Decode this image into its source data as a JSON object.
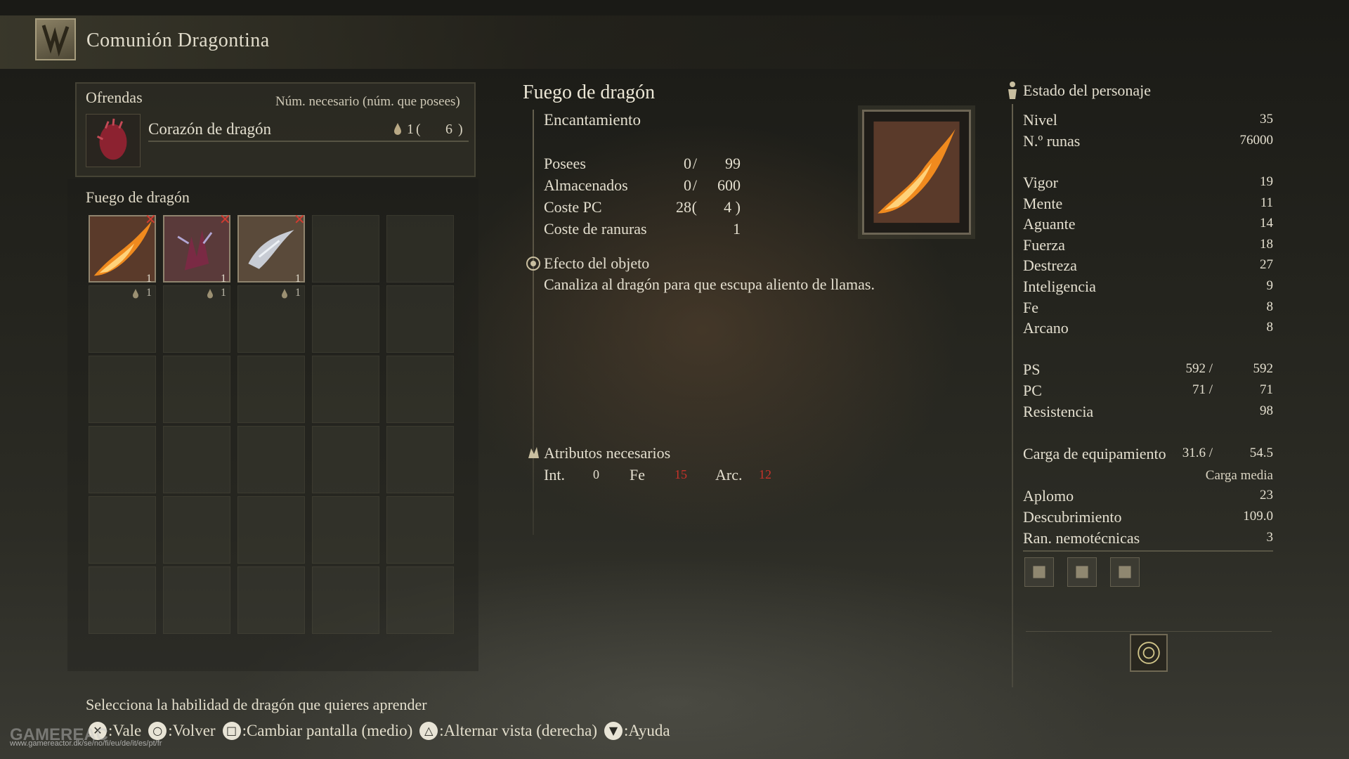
{
  "header": {
    "title": "Comunión Dragontina",
    "icon": "dragon-communion-icon"
  },
  "offerings": {
    "title": "Ofrendas",
    "column_header": "Núm. necesario (núm. que posees)",
    "item": {
      "name": "Corazón de dragón",
      "required": "1",
      "paren_open": "(",
      "owned": "6",
      "paren_close": ")",
      "icon": "dragon-heart-icon"
    }
  },
  "grid": {
    "title": "Fuego de dragón",
    "items": [
      {
        "icon": "dragonfire-icon",
        "qty": "1",
        "cost": "1",
        "remove": "✕"
      },
      {
        "icon": "dragonclaw-icon",
        "qty": "1",
        "cost": "1",
        "remove": "✕"
      },
      {
        "icon": "dragonice-icon",
        "qty": "1",
        "cost": "1",
        "remove": "✕"
      }
    ]
  },
  "detail": {
    "name": "Fuego de dragón",
    "type": "Encantamiento",
    "stats": [
      {
        "label": "Posees",
        "v1": "0",
        "sep": "/",
        "v2": "99"
      },
      {
        "label": "Almacenados",
        "v1": "0",
        "sep": "/",
        "v2": "600"
      },
      {
        "label": "Coste PC",
        "v1": "28",
        "sep": "(",
        "v2": "4 )"
      },
      {
        "label": "Coste de ranuras",
        "v1": "",
        "sep": "",
        "v2": "1"
      }
    ],
    "effect_title": "Efecto del objeto",
    "effect_desc": "Canaliza al dragón para que escupa aliento de llamas.",
    "attributes_title": "Atributos necesarios",
    "attributes": [
      {
        "label": "Int.",
        "value": "0",
        "color": "#e4dfcf"
      },
      {
        "label": "Fe",
        "value": "15",
        "color": "#c8322a"
      },
      {
        "label": "Arc.",
        "value": "12",
        "color": "#c8322a"
      }
    ]
  },
  "character": {
    "title": "Estado del personaje",
    "level_label": "Nivel",
    "level": "35",
    "runes_label": "N.º runas",
    "runes": "76000",
    "attributes": [
      {
        "label": "Vigor",
        "value": "19"
      },
      {
        "label": "Mente",
        "value": "11"
      },
      {
        "label": "Aguante",
        "value": "14"
      },
      {
        "label": "Fuerza",
        "value": "18"
      },
      {
        "label": "Destreza",
        "value": "27"
      },
      {
        "label": "Inteligencia",
        "value": "9"
      },
      {
        "label": "Fe",
        "value": "8"
      },
      {
        "label": "Arcano",
        "value": "8"
      }
    ],
    "hp_label": "PS",
    "hp_cur": "592 /",
    "hp_max": "592",
    "fp_label": "PC",
    "fp_cur": "71 /",
    "fp_max": "71",
    "stamina_label": "Resistencia",
    "stamina": "98",
    "load_label": "Carga de equipamiento",
    "load_cur": "31.6 /",
    "load_max": "54.5",
    "load_state": "Carga media",
    "poise_label": "Aplomo",
    "poise": "23",
    "discovery_label": "Descubrimiento",
    "discovery": "109.0",
    "memory_label": "Ran. nemotécnicas",
    "memory": "3"
  },
  "footer": {
    "hint": "Selecciona la habilidad de dragón que quieres aprender",
    "prompts": [
      {
        "glyph": "✕",
        "label": ":Vale"
      },
      {
        "glyph": "○",
        "label": ":Volver"
      },
      {
        "glyph": "□",
        "label": ":Cambiar pantalla (medio)"
      },
      {
        "glyph": "△",
        "label": ":Alternar vista (derecha)"
      },
      {
        "glyph": "▼",
        "label": ":Ayuda"
      }
    ]
  },
  "watermark": {
    "brand": "GAMEREAC",
    "sub": "www.gamereactor.dk/se/no/fi/eu/de/it/es/pt/fr"
  }
}
